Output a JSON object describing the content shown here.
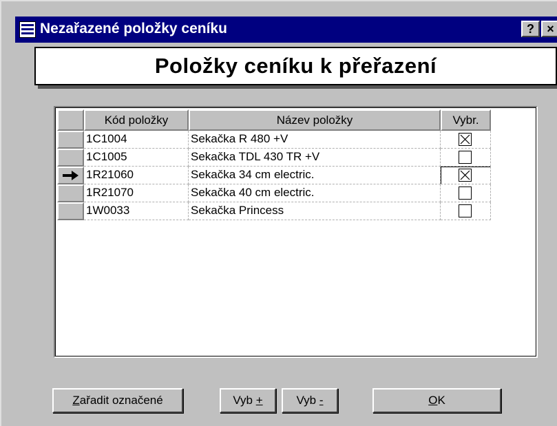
{
  "window": {
    "title": "Nezařazené položky ceníku",
    "help_label": "?",
    "close_label": "×"
  },
  "banner": {
    "title": "Položky ceníku k přeřazení"
  },
  "grid": {
    "columns": [
      "Kód položky",
      "Název položky",
      "Vybr."
    ],
    "current_row_indicator": "arrow-right-icon",
    "rows": [
      {
        "kod": "1C1004",
        "nazev": "Sekačka R 480 +V",
        "vybrano": true,
        "current": false
      },
      {
        "kod": "1C1005",
        "nazev": "Sekačka TDL 430 TR +V",
        "vybrano": false,
        "current": false
      },
      {
        "kod": "1R21060",
        "nazev": "Sekačka 34 cm electric.",
        "vybrano": true,
        "current": true
      },
      {
        "kod": "1R21070",
        "nazev": "Sekačka 40 cm electric.",
        "vybrano": false,
        "current": false
      },
      {
        "kod": "1W0033",
        "nazev": "Sekačka Princess",
        "vybrano": false,
        "current": false
      }
    ]
  },
  "buttons": {
    "zaradit": {
      "mnemonic": "Z",
      "rest": "ařadit označené"
    },
    "vyb_plus": {
      "text": "Vyb ",
      "mnemonic": "+"
    },
    "vyb_minus": {
      "text": "Vyb ",
      "mnemonic": "-"
    },
    "ok": {
      "mnemonic": "O",
      "rest": "K"
    }
  },
  "colors": {
    "titlebar": "#000080",
    "face": "#c0c0c0",
    "grid_background": "#ffffff"
  }
}
